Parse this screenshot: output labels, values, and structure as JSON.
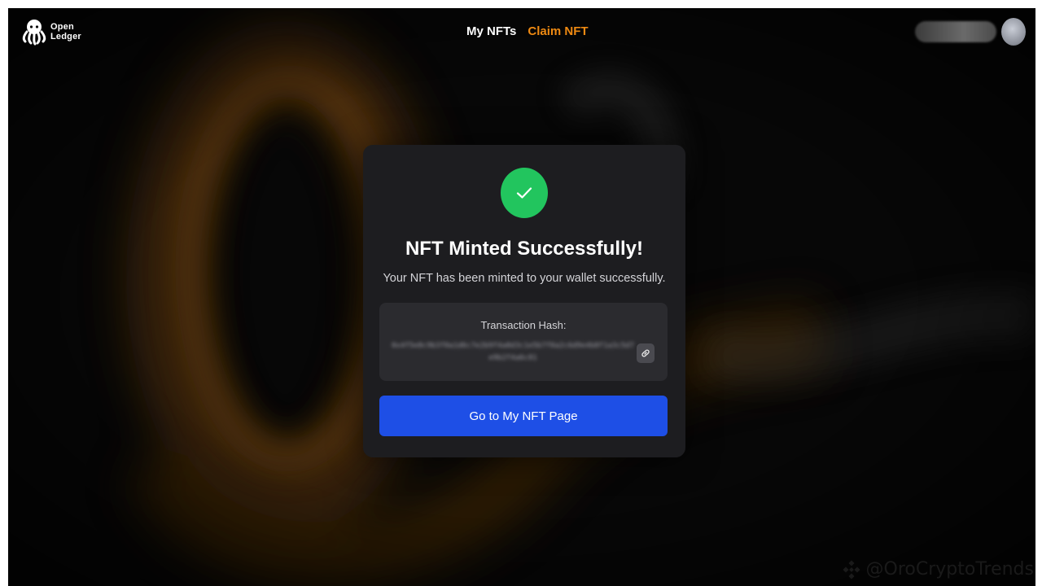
{
  "header": {
    "logo_line1": "Open",
    "logo_line2": "Ledger",
    "nav": {
      "my_nfts": "My NFTs",
      "claim_nft": "Claim NFT"
    }
  },
  "modal": {
    "title": "NFT Minted Successfully!",
    "subtitle": "Your NFT has been minted to your wallet successfully.",
    "hash_label": "Transaction Hash:",
    "hash_value": "0x4f5e8c9b3f0a1d6c7e2b9f4a8d3c1e5b7f0a2c6d9e4b8f1a3c5d7e9b2f4a6c81",
    "cta_label": "Go to My NFT Page"
  },
  "watermark": {
    "text": "@OroCryptoTrends"
  },
  "colors": {
    "accent_orange": "#ef8a12",
    "success_green": "#22c55e",
    "primary_blue": "#1e4fe6"
  },
  "icons": {
    "success": "check-icon",
    "copy": "link-icon",
    "logo": "octopus-logo"
  }
}
